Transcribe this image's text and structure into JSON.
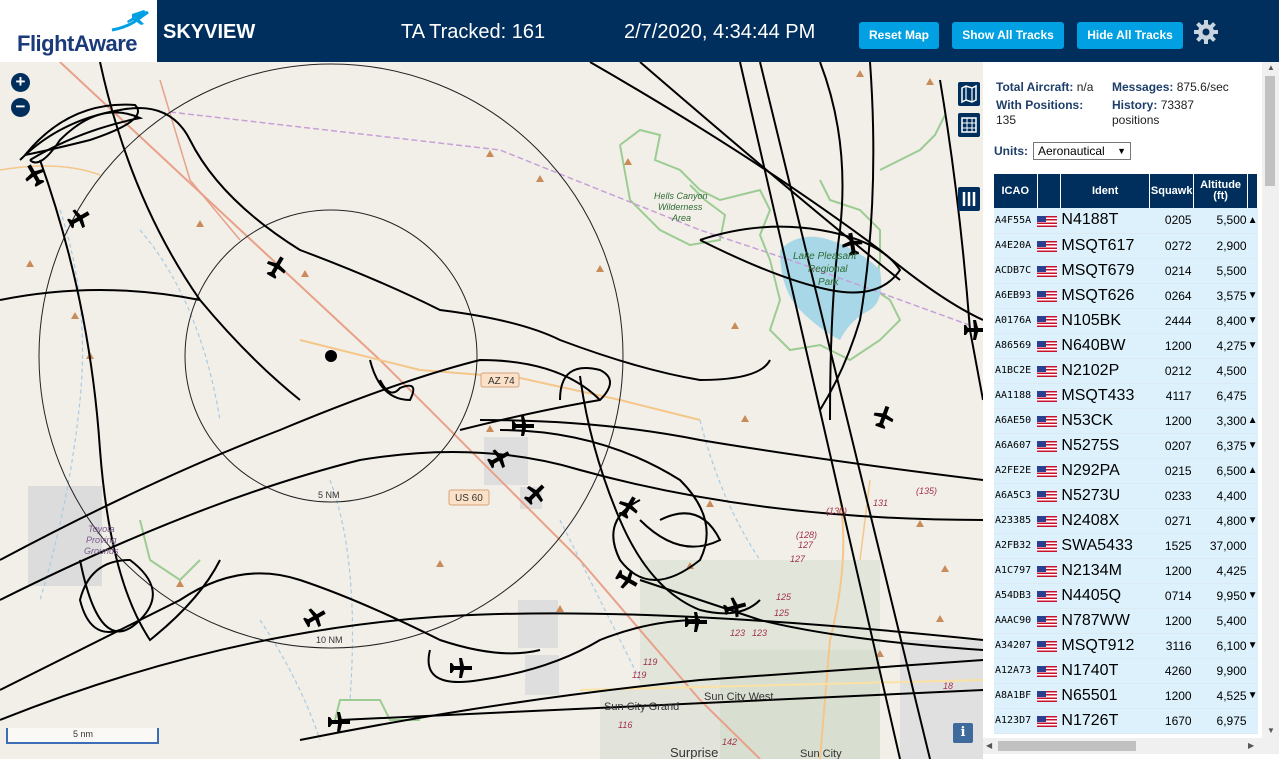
{
  "header": {
    "logo_text": "FlightAware",
    "app_title": "SKYVIEW",
    "tracked": "TA Tracked: 161",
    "datetime": "2/7/2020, 4:34:44 PM",
    "buttons": {
      "reset": "Reset Map",
      "show": "Show All Tracks",
      "hide": "Hide All Tracks"
    },
    "settings_icon": "gear-icon",
    "colors": {
      "bar": "#002f5d",
      "button": "#00a0e2"
    }
  },
  "map": {
    "labels": {
      "hells_canyon": "Hells Canyon",
      "wilderness": "Wilderness",
      "area": "Area",
      "lake1": "Lake Pleasant",
      "lake2": "Regional",
      "lake3": "Park",
      "az74": "AZ 74",
      "us60": "US 60",
      "ring5": "5 NM",
      "ring10": "10 NM",
      "toyota1": "Toyota",
      "toyota2": "Proving",
      "toyota3": "Grounds",
      "sun_city_west": "Sun City West",
      "sun_city_grand": "Sun City Grand",
      "surprise": "Surprise",
      "sun_city": "Sun City",
      "r135": "(135)",
      "r130": "(130)",
      "r128": "(128)",
      "r127a": "127",
      "r127b": "127",
      "r131": "131",
      "r125a": "125",
      "r125b": "125",
      "r123a": "123",
      "r123b": "123",
      "r119": "119",
      "r119b": "119",
      "r116": "116",
      "r142": "142",
      "r18": "18"
    },
    "scale": "5 nm",
    "info": "i",
    "zoom_in": "+",
    "zoom_out": "−"
  },
  "stats": {
    "total_label": "Total Aircraft:",
    "total_value": "n/a",
    "messages_label": "Messages:",
    "messages_value": "875.6/sec",
    "positions_label": "With Positions:",
    "positions_value": "135",
    "history_label": "History:",
    "history_value": "73387",
    "history_unit": "positions"
  },
  "units": {
    "label": "Units:",
    "selected": "Aeronautical"
  },
  "table": {
    "headers": {
      "icao": "ICAO",
      "ident": "Ident",
      "squawk": "Squawk",
      "alt1": "Altitude",
      "alt2": "(ft)"
    },
    "rows": [
      {
        "icao": "A4F55A",
        "ident": "N4188T",
        "squawk": "0205",
        "alt": "5,500",
        "trend": "▲"
      },
      {
        "icao": "A4E20A",
        "ident": "MSQT617",
        "squawk": "0272",
        "alt": "2,900",
        "trend": ""
      },
      {
        "icao": "ACDB7C",
        "ident": "MSQT679",
        "squawk": "0214",
        "alt": "5,500",
        "trend": ""
      },
      {
        "icao": "A6EB93",
        "ident": "MSQT626",
        "squawk": "0264",
        "alt": "3,575",
        "trend": "▼"
      },
      {
        "icao": "A0176A",
        "ident": "N105BK",
        "squawk": "2444",
        "alt": "8,400",
        "trend": "▼"
      },
      {
        "icao": "A86569",
        "ident": "N640BW",
        "squawk": "1200",
        "alt": "4,275",
        "trend": "▼"
      },
      {
        "icao": "A1BC2E",
        "ident": "N2102P",
        "squawk": "0212",
        "alt": "4,500",
        "trend": ""
      },
      {
        "icao": "AA1188",
        "ident": "MSQT433",
        "squawk": "4117",
        "alt": "6,475",
        "trend": ""
      },
      {
        "icao": "A6AE50",
        "ident": "N53CK",
        "squawk": "1200",
        "alt": "3,300",
        "trend": "▲"
      },
      {
        "icao": "A6A607",
        "ident": "N5275S",
        "squawk": "0207",
        "alt": "6,375",
        "trend": "▼"
      },
      {
        "icao": "A2FE2E",
        "ident": "N292PA",
        "squawk": "0215",
        "alt": "6,500",
        "trend": "▲"
      },
      {
        "icao": "A6A5C3",
        "ident": "N5273U",
        "squawk": "0233",
        "alt": "4,400",
        "trend": ""
      },
      {
        "icao": "A23385",
        "ident": "N2408X",
        "squawk": "0271",
        "alt": "4,800",
        "trend": "▼"
      },
      {
        "icao": "A2FB32",
        "ident": "SWA5433",
        "squawk": "1525",
        "alt": "37,000",
        "trend": ""
      },
      {
        "icao": "A1C797",
        "ident": "N2134M",
        "squawk": "1200",
        "alt": "4,425",
        "trend": ""
      },
      {
        "icao": "A54DB3",
        "ident": "N4405Q",
        "squawk": "0714",
        "alt": "9,950",
        "trend": "▼"
      },
      {
        "icao": "AAAC90",
        "ident": "N787WW",
        "squawk": "1200",
        "alt": "5,400",
        "trend": ""
      },
      {
        "icao": "A34207",
        "ident": "MSQT912",
        "squawk": "3116",
        "alt": "6,100",
        "trend": "▼"
      },
      {
        "icao": "A12A73",
        "ident": "N1740T",
        "squawk": "4260",
        "alt": "9,900",
        "trend": ""
      },
      {
        "icao": "A8A1BF",
        "ident": "N65501",
        "squawk": "1200",
        "alt": "4,525",
        "trend": "▼"
      },
      {
        "icao": "A123D7",
        "ident": "N1726T",
        "squawk": "1670",
        "alt": "6,975",
        "trend": ""
      }
    ]
  }
}
